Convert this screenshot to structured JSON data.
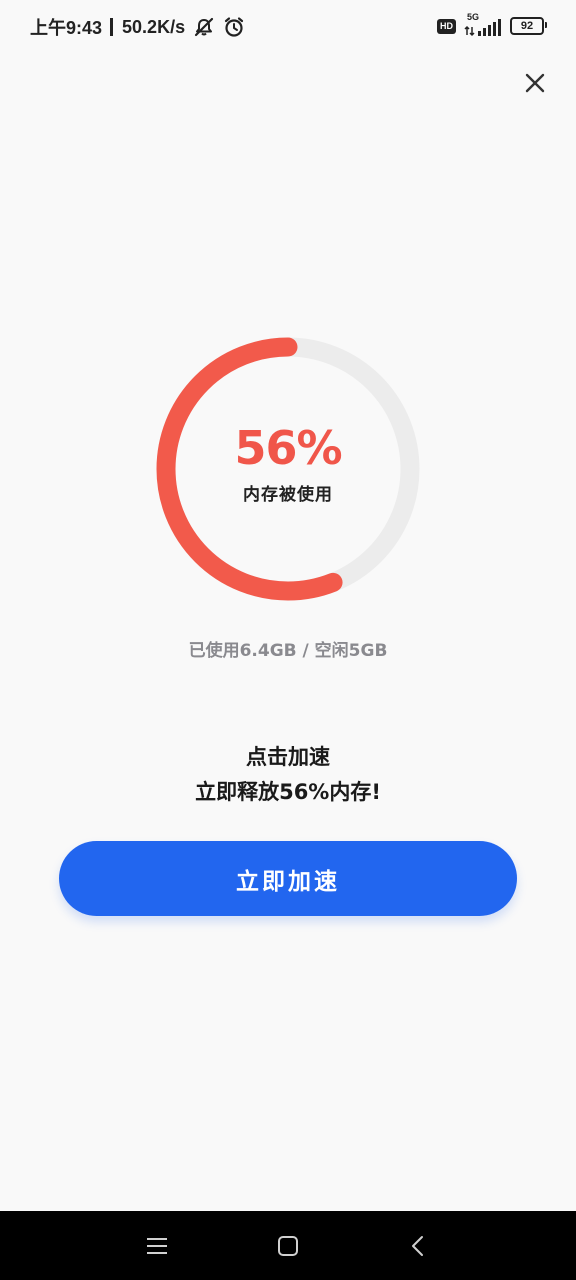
{
  "status_bar": {
    "time": "上午9:43",
    "net_speed": "50.2K/s",
    "hd": "HD",
    "network": "5G",
    "battery": "92",
    "icons": [
      "mute-icon",
      "alarm-icon",
      "signal-icon",
      "battery-icon"
    ]
  },
  "header": {
    "close_icon": "close-icon"
  },
  "gauge": {
    "percent_used": 56,
    "percent_text": "56%",
    "label": "内存被使用",
    "colors": {
      "progress": "#f25a4b",
      "track": "#ececec"
    }
  },
  "usage": {
    "text": "已使用6.4GB / 空闲5GB"
  },
  "promo": {
    "line1": "点击加速",
    "line2": "立即释放56%内存!"
  },
  "action": {
    "boost_label": "立即加速",
    "color": "#2266ef"
  },
  "nav_bar": {
    "icons": [
      "menu-icon",
      "home-icon",
      "back-icon"
    ]
  }
}
